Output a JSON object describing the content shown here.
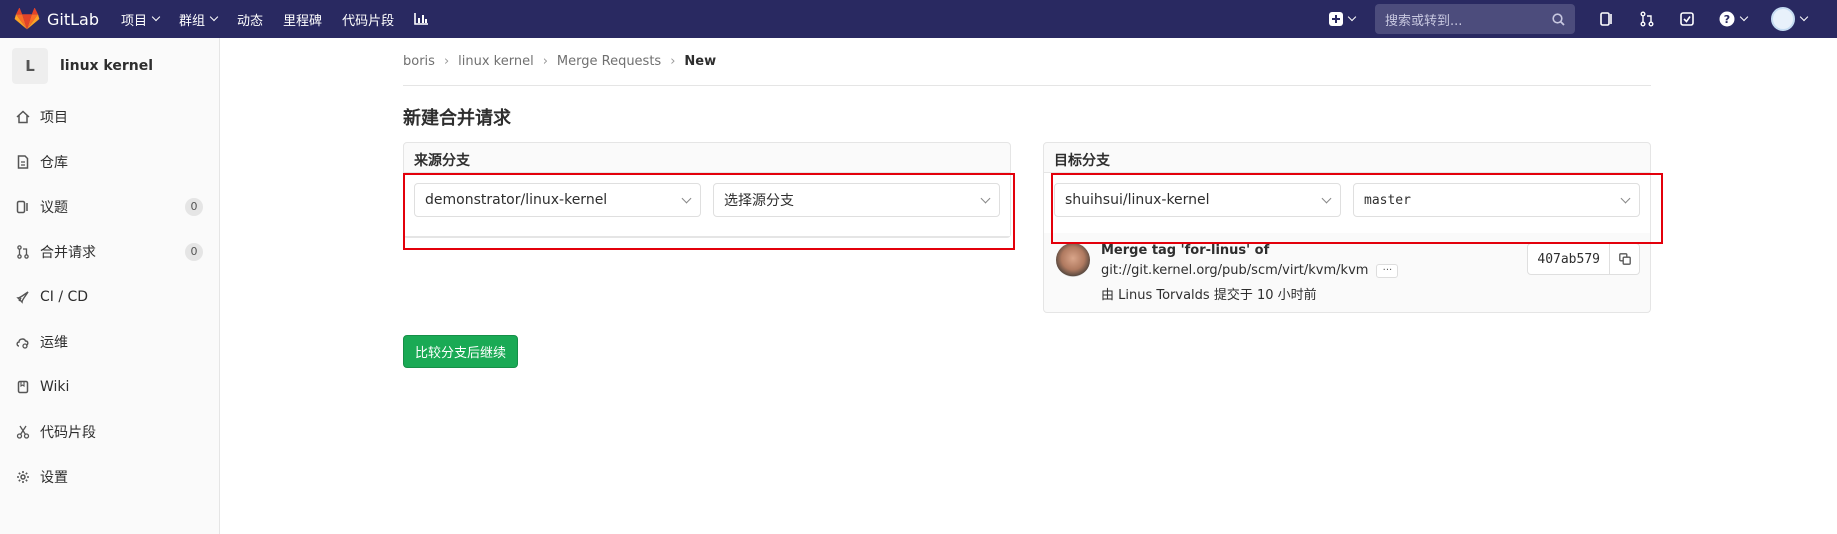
{
  "navbar": {
    "brand": "GitLab",
    "links": [
      {
        "label": "项目",
        "dropdown": true
      },
      {
        "label": "群组",
        "dropdown": true
      },
      {
        "label": "动态",
        "dropdown": false
      },
      {
        "label": "里程碑",
        "dropdown": false
      },
      {
        "label": "代码片段",
        "dropdown": false
      }
    ],
    "search_placeholder": "搜索或转到...",
    "icons": [
      "plus-icon",
      "search-icon",
      "issues-icon",
      "merge-request-icon",
      "todo-icon",
      "help-icon",
      "user-avatar"
    ]
  },
  "sidebar": {
    "project_initial": "L",
    "project_name": "linux kernel",
    "items": [
      {
        "label": "项目",
        "icon": "home-icon"
      },
      {
        "label": "仓库",
        "icon": "doc-icon"
      },
      {
        "label": "议题",
        "icon": "issues-icon",
        "count": "0"
      },
      {
        "label": "合并请求",
        "icon": "merge-request-icon",
        "count": "0"
      },
      {
        "label": "CI / CD",
        "icon": "rocket-icon"
      },
      {
        "label": "运维",
        "icon": "cloud-gear-icon"
      },
      {
        "label": "Wiki",
        "icon": "book-icon"
      },
      {
        "label": "代码片段",
        "icon": "scissors-icon"
      },
      {
        "label": "设置",
        "icon": "gear-icon"
      }
    ]
  },
  "breadcrumb": [
    "boris",
    "linux kernel",
    "Merge Requests",
    "New"
  ],
  "page_title": "新建合并请求",
  "source": {
    "heading": "来源分支",
    "project": "demonstrator/linux-kernel",
    "branch_placeholder": "选择源分支"
  },
  "target": {
    "heading": "目标分支",
    "project": "shuihsui/linux-kernel",
    "branch": "master"
  },
  "commit": {
    "title": "Merge tag 'for-linus' of",
    "path": "git://git.kernel.org/pub/scm/virt/kvm/kvm",
    "ellipsis": "···",
    "author_line": "由 Linus Torvalds 提交于 10 小时前",
    "sha": "407ab579"
  },
  "submit_label": "比较分支后继续",
  "colors": {
    "navbar": "#292961",
    "success": "#1aaa55",
    "highlight": "#e3000b"
  }
}
